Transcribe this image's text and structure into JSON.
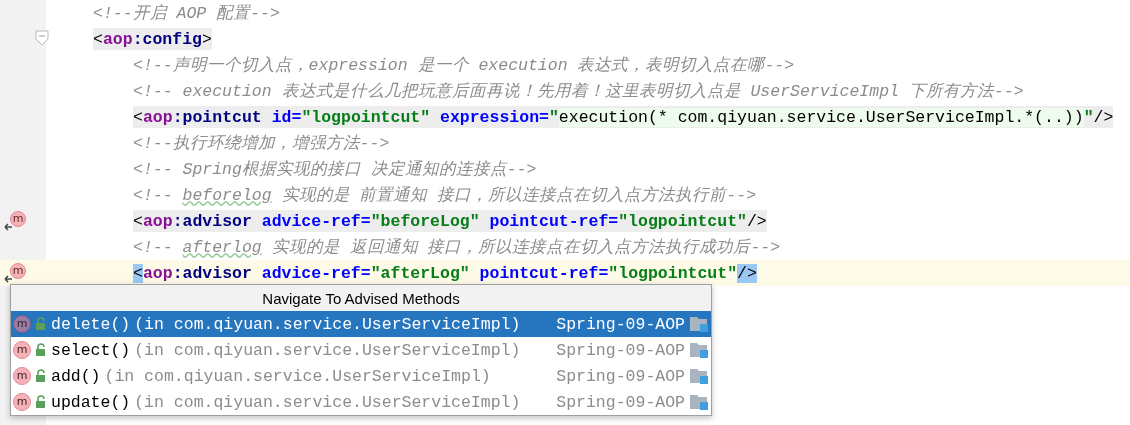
{
  "editor": {
    "lines": [
      {
        "foldable": false,
        "current": false,
        "matched": false,
        "tokens": [
          {
            "kind": "comment",
            "text": "<!--开启 AOP 配置-->"
          }
        ]
      },
      {
        "foldable": true,
        "current": false,
        "matched": true,
        "tokens": [
          {
            "kind": "punct",
            "text": "<"
          },
          {
            "kind": "ns",
            "text": "aop"
          },
          {
            "kind": "tag",
            "text": ":config"
          },
          {
            "kind": "punct",
            "text": ">"
          }
        ],
        "children": [
          {
            "foldable": false,
            "current": false,
            "matched": false,
            "tokens": [
              {
                "kind": "comment",
                "text": "<!--声明一个切入点，expression 是一个 execution 表达式，表明切入点在哪-->"
              }
            ]
          },
          {
            "foldable": false,
            "current": false,
            "matched": false,
            "tokens": [
              {
                "kind": "comment",
                "text": "<!-- execution 表达式是什么几把玩意后面再说！先用着！这里表明切入点是 UserServiceImpl 下所有方法-->"
              }
            ]
          },
          {
            "foldable": false,
            "current": false,
            "matched": true,
            "tokens": [
              {
                "kind": "punct",
                "text": "<"
              },
              {
                "kind": "ns",
                "text": "aop"
              },
              {
                "kind": "tag",
                "text": ":pointcut "
              },
              {
                "kind": "attr",
                "text": "id="
              },
              {
                "kind": "value",
                "text": "\"logpointcut\""
              },
              {
                "kind": "attr",
                "text": " expression="
              },
              {
                "kind": "value",
                "text": "\""
              },
              {
                "kind": "inject",
                "text": "execution(* com.qiyuan.service.UserServiceImpl.*(..))"
              },
              {
                "kind": "value",
                "text": "\""
              },
              {
                "kind": "punct",
                "text": "/>"
              }
            ]
          },
          {
            "foldable": false,
            "current": false,
            "matched": false,
            "tokens": [
              {
                "kind": "comment",
                "text": "<!--执行环绕增加，增强方法-->"
              }
            ]
          },
          {
            "foldable": false,
            "current": false,
            "matched": false,
            "tokens": [
              {
                "kind": "comment",
                "text": "<!-- Spring根据实现的接口 决定通知的连接点-->"
              }
            ]
          },
          {
            "foldable": false,
            "current": false,
            "matched": false,
            "tokens": [
              {
                "kind": "comment",
                "text": "<!-- "
              },
              {
                "kind": "comment-typo",
                "text": "beforelog"
              },
              {
                "kind": "comment",
                "text": " 实现的是 前置通知 接口，所以连接点在切入点方法执行前-->"
              }
            ]
          },
          {
            "foldable": false,
            "gutter_icon": "m",
            "current": false,
            "matched": true,
            "tokens": [
              {
                "kind": "punct",
                "text": "<"
              },
              {
                "kind": "ns",
                "text": "aop"
              },
              {
                "kind": "tag",
                "text": ":advisor "
              },
              {
                "kind": "attr",
                "text": "advice-ref="
              },
              {
                "kind": "value",
                "text": "\"beforeLog\""
              },
              {
                "kind": "attr",
                "text": " pointcut-ref="
              },
              {
                "kind": "value",
                "text": "\"logpointcut\""
              },
              {
                "kind": "punct",
                "text": "/>"
              }
            ]
          },
          {
            "foldable": false,
            "current": false,
            "matched": false,
            "tokens": [
              {
                "kind": "comment",
                "text": "<!-- "
              },
              {
                "kind": "comment-typo",
                "text": "afterlog"
              },
              {
                "kind": "comment",
                "text": " 实现的是 返回通知 接口，所以连接点在切入点方法执行成功后-->"
              }
            ]
          },
          {
            "foldable": false,
            "gutter_icon": "m",
            "current": true,
            "matched": false,
            "tokens": [
              {
                "kind": "brace",
                "text": "<"
              },
              {
                "kind": "ns",
                "text": "aop"
              },
              {
                "kind": "tag",
                "text": ":advisor "
              },
              {
                "kind": "attr",
                "text": "advice-ref="
              },
              {
                "kind": "value",
                "text": "\"afterLog\""
              },
              {
                "kind": "attr",
                "text": " pointcut-ref="
              },
              {
                "kind": "value",
                "text": "\"logpointcut\""
              },
              {
                "kind": "brace",
                "text": "/>"
              }
            ]
          }
        ]
      }
    ]
  },
  "popup": {
    "title": "Navigate To Advised Methods",
    "items": [
      {
        "icon": "m",
        "name": "delete()",
        "location": "(in com.qiyuan.service.UserServiceImpl)",
        "module": "Spring-09-AOP",
        "selected": true
      },
      {
        "icon": "m",
        "name": "select()",
        "location": "(in com.qiyuan.service.UserServiceImpl)",
        "module": "Spring-09-AOP",
        "selected": false
      },
      {
        "icon": "m",
        "name": "add()",
        "location": "(in com.qiyuan.service.UserServiceImpl)",
        "module": "Spring-09-AOP",
        "selected": false
      },
      {
        "icon": "m",
        "name": "update()",
        "location": "(in com.qiyuan.service.UserServiceImpl)",
        "module": "Spring-09-AOP",
        "selected": false
      }
    ]
  }
}
